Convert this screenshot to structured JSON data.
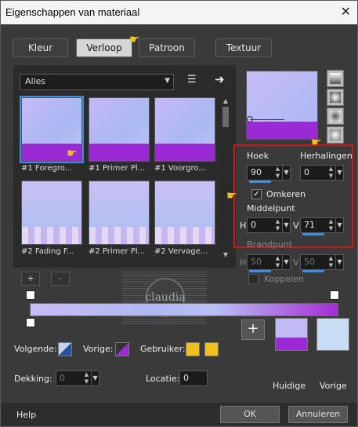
{
  "window": {
    "title": "Eigenschappen van materiaal",
    "close": "✕"
  },
  "tabs": [
    {
      "label": "Kleur"
    },
    {
      "label": "Verloop"
    },
    {
      "label": "Patroon"
    },
    {
      "label": "Textuur"
    }
  ],
  "library": {
    "category": "Alles"
  },
  "thumbnails": [
    {
      "label": "#1 Foregro..."
    },
    {
      "label": "#1 Primer Pl..."
    },
    {
      "label": "#1 Voorgro..."
    },
    {
      "label": "#2 Fading F..."
    },
    {
      "label": "#2 Primer Pl..."
    },
    {
      "label": "#2 Vervage..."
    }
  ],
  "settings": {
    "hoek": {
      "label": "Hoek",
      "value": "90"
    },
    "herhalingen": {
      "label": "Herhalingen",
      "value": "0"
    },
    "omkeren": {
      "label": "Omkeren",
      "checked": true
    },
    "middelpunt": {
      "label": "Middelpunt",
      "h": "0",
      "v": "71",
      "h_label": "H",
      "v_label": "V"
    },
    "brandpunt": {
      "label": "Brandpunt",
      "h": "50",
      "v": "50",
      "h_label": "H",
      "v_label": "V"
    },
    "koppelen": {
      "label": "Koppelen",
      "checked": false
    }
  },
  "stops": {
    "add": "+",
    "remove": "-"
  },
  "watermark": {
    "text": "claudia"
  },
  "colors": {
    "volgende_label": "Volgende:",
    "vorige_label": "Vorige:",
    "gebruiker_label": "Gebruiker:",
    "accent": "#3d8ee0",
    "grad_purple": "#9b2ad4",
    "grad_lavender": "#c6bcf7",
    "user_yellow": "#f0c020",
    "vorige_swatch": "#c8dcf4"
  },
  "bottom": {
    "dekking_label": "Dekking:",
    "dekking_value": "0",
    "locatie_label": "Locatie:",
    "locatie_value": "0"
  },
  "swatches": {
    "huidige": "Huidige",
    "vorige": "Vorige",
    "add": "+"
  },
  "footer": {
    "help": "Help",
    "ok": "OK",
    "cancel": "Annuleren"
  }
}
